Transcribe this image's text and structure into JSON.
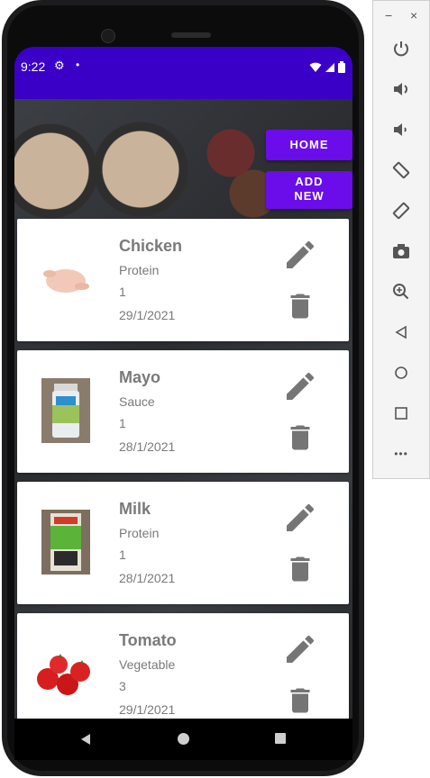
{
  "status_bar": {
    "time": "9:22",
    "gear_icon": "gear-icon",
    "dot": "•"
  },
  "buttons": {
    "home": "HOME",
    "add_new_line1": "ADD",
    "add_new_line2": "NEW"
  },
  "items": [
    {
      "name": "Chicken",
      "category": "Protein",
      "quantity": "1",
      "date": "29/1/2021",
      "image": "chicken-image"
    },
    {
      "name": "Mayo",
      "category": "Sauce",
      "quantity": "1",
      "date": "28/1/2021",
      "image": "mayo-jar-image"
    },
    {
      "name": "Milk",
      "category": "Protein",
      "quantity": "1",
      "date": "28/1/2021",
      "image": "milk-carton-image"
    },
    {
      "name": "Tomato",
      "category": "Vegetable",
      "quantity": "3",
      "date": "29/1/2021",
      "image": "tomato-image"
    }
  ],
  "toolbar": {
    "minimize": "−",
    "close": "×",
    "more": "•••"
  },
  "colors": {
    "status_bar": "#3b00c7",
    "accent_button": "#6a0dea",
    "icon_gray": "#757575",
    "text_gray": "#7a7a7a"
  }
}
